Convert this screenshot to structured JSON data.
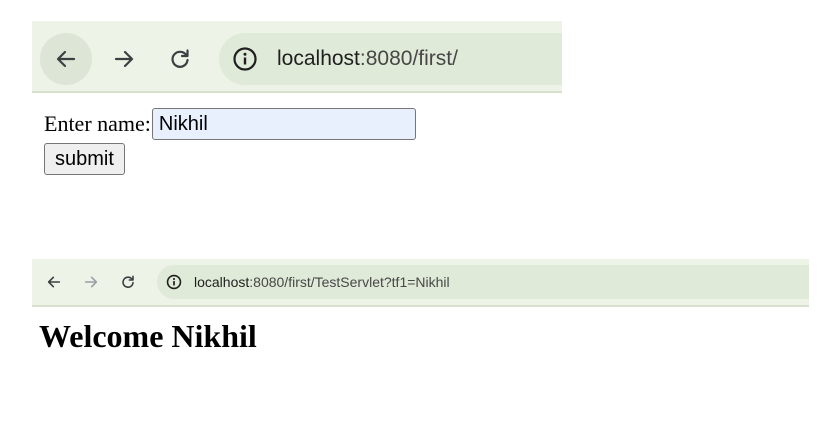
{
  "window1": {
    "toolbar": {
      "back_icon": "arrow-left-icon",
      "forward_icon": "arrow-right-icon",
      "reload_icon": "reload-icon",
      "info_icon": "info-circle-icon"
    },
    "address": {
      "host": "localhost",
      "path": ":8080/first/"
    },
    "form": {
      "label": "Enter name:",
      "input_value": "Nikhil",
      "submit_label": "submit"
    }
  },
  "window2": {
    "toolbar": {
      "back_icon": "arrow-left-icon",
      "forward_icon": "arrow-right-icon",
      "reload_icon": "reload-icon",
      "info_icon": "info-circle-icon"
    },
    "address": {
      "host": "localhost",
      "path": ":8080/first/TestServlet?tf1=Nikhil"
    },
    "heading": "Welcome Nikhil"
  },
  "colors": {
    "toolbar_bg": "#edf3e7",
    "omnibox_bg": "#e0ead8",
    "autofill_bg": "#e8f0fe",
    "icon": "#3c4043",
    "icon_disabled": "#9aa0a6"
  }
}
